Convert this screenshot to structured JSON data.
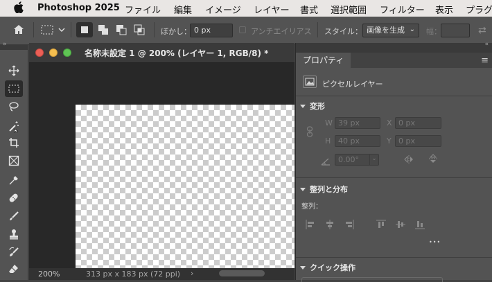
{
  "menubar": {
    "app_name": "Photoshop 2025",
    "items": [
      "ファイル",
      "編集",
      "イメージ",
      "レイヤー",
      "書式",
      "選択範囲",
      "フィルター",
      "表示",
      "プラグ"
    ]
  },
  "options_bar": {
    "feather_label": "ぼかし：",
    "feather_value": "0 px",
    "antialias_label": "アンチエイリアス",
    "style_label": "スタイル：",
    "style_value": "画像を生成",
    "width_label": "幅："
  },
  "document": {
    "title": "名称未設定 1 @ 200% (レイヤー 1, RGB/8) *",
    "zoom": "200%",
    "doc_info": "313 px x 183 px (72 ppi)",
    "status_arrow": "›"
  },
  "properties": {
    "tab_label": "プロパティ",
    "layer_type": "ピクセルレイヤー",
    "transform": {
      "title": "変形",
      "w_label": "W",
      "w_value": "39 px",
      "h_label": "H",
      "h_value": "40 px",
      "x_label": "X",
      "x_value": "0 px",
      "y_label": "Y",
      "y_value": "0 px",
      "angle_value": "0.00°"
    },
    "align": {
      "title": "整列と分布",
      "subtitle": "整列：",
      "more": "•••"
    },
    "quick_actions": {
      "title": "クイック操作"
    }
  },
  "colors": {
    "menubar_bg": "#e9e6e4",
    "panel_bg": "#535353",
    "dark_bg": "#282828",
    "traffic_red": "#ec5f56",
    "traffic_yellow": "#f5be4f",
    "traffic_green": "#5fc454"
  },
  "icons": [
    "apple-icon",
    "home-icon",
    "marquee-icon",
    "move-tool-icon",
    "lasso-icon",
    "magic-wand-icon",
    "crop-icon",
    "frame-icon",
    "eyedropper-icon",
    "healing-icon",
    "brush-icon",
    "stamp-icon",
    "history-brush-icon",
    "eraser-icon",
    "link-icon",
    "flip-icon"
  ]
}
